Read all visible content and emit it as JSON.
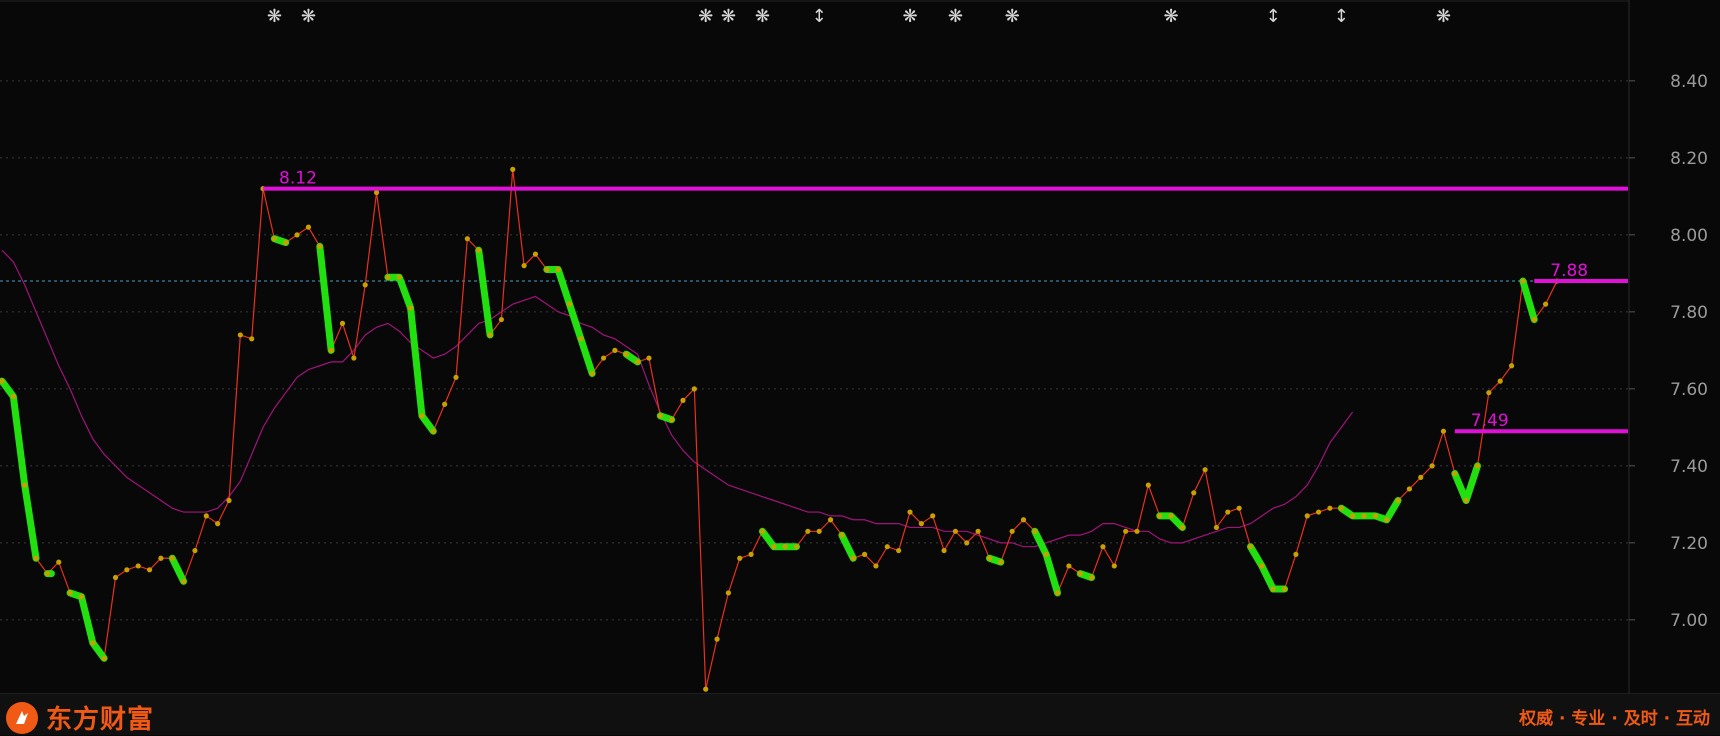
{
  "chart_data": {
    "type": "line",
    "ylim": [
      6.81,
      8.61
    ],
    "y_ticks": [
      "8.40",
      "8.20",
      "8.00",
      "7.80",
      "7.60",
      "7.40",
      "7.20",
      "7.00"
    ],
    "grid": true,
    "series": [
      {
        "role": "price",
        "color": "#e8301c",
        "marker_color": "#c8a000",
        "values": [
          7.62,
          7.58,
          7.35,
          7.16,
          7.12,
          7.15,
          7.07,
          7.06,
          6.94,
          6.9,
          7.11,
          7.13,
          7.14,
          7.13,
          7.16,
          7.16,
          7.1,
          7.18,
          7.27,
          7.25,
          7.31,
          7.74,
          7.73,
          8.12,
          7.99,
          7.98,
          8.0,
          8.02,
          7.97,
          7.7,
          7.77,
          7.68,
          7.87,
          8.11,
          7.89,
          7.89,
          7.81,
          7.53,
          7.49,
          7.56,
          7.63,
          7.99,
          7.96,
          7.74,
          7.78,
          8.17,
          7.92,
          7.95,
          7.91,
          7.91,
          7.82,
          7.73,
          7.64,
          7.68,
          7.7,
          7.69,
          7.67,
          7.68,
          7.53,
          7.52,
          7.57,
          7.6,
          6.82,
          6.95,
          7.07,
          7.16,
          7.17,
          7.23,
          7.19,
          7.19,
          7.19,
          7.23,
          7.23,
          7.26,
          7.22,
          7.16,
          7.17,
          7.14,
          7.19,
          7.18,
          7.28,
          7.25,
          7.27,
          7.18,
          7.23,
          7.2,
          7.23,
          7.16,
          7.15,
          7.23,
          7.26,
          7.23,
          7.17,
          7.07,
          7.14,
          7.12,
          7.11,
          7.19,
          7.14,
          7.23,
          7.23,
          7.35,
          7.27,
          7.27,
          7.24,
          7.33,
          7.39,
          7.24,
          7.28,
          7.29,
          7.19,
          7.14,
          7.08,
          7.08,
          7.17,
          7.27,
          7.28,
          7.29,
          7.29,
          7.27,
          7.27,
          7.27,
          7.26,
          7.31,
          7.34,
          7.37,
          7.4,
          7.49,
          7.38,
          7.31,
          7.4,
          7.59,
          7.62,
          7.66,
          7.88,
          7.78,
          7.82,
          7.88
        ]
      },
      {
        "role": "moving-average",
        "color": "#a0147a",
        "values": [
          7.96,
          7.93,
          7.87,
          7.8,
          7.73,
          7.66,
          7.6,
          7.53,
          7.47,
          7.43,
          7.4,
          7.37,
          7.35,
          7.33,
          7.31,
          7.29,
          7.28,
          7.28,
          7.28,
          7.29,
          7.32,
          7.36,
          7.43,
          7.5,
          7.55,
          7.59,
          7.63,
          7.65,
          7.66,
          7.67,
          7.67,
          7.7,
          7.74,
          7.76,
          7.77,
          7.75,
          7.72,
          7.7,
          7.68,
          7.69,
          7.71,
          7.74,
          7.77,
          7.78,
          7.8,
          7.82,
          7.83,
          7.84,
          7.82,
          7.8,
          7.79,
          7.77,
          7.76,
          7.74,
          7.73,
          7.71,
          7.69,
          7.61,
          7.54,
          7.48,
          7.44,
          7.41,
          7.39,
          7.37,
          7.35,
          7.34,
          7.33,
          7.32,
          7.31,
          7.3,
          7.29,
          7.28,
          7.28,
          7.27,
          7.27,
          7.26,
          7.26,
          7.25,
          7.25,
          7.25,
          7.24,
          7.24,
          7.24,
          7.23,
          7.23,
          7.23,
          7.22,
          7.21,
          7.2,
          7.2,
          7.19,
          7.19,
          7.2,
          7.21,
          7.22,
          7.22,
          7.23,
          7.25,
          7.25,
          7.24,
          7.23,
          7.23,
          7.21,
          7.2,
          7.2,
          7.21,
          7.22,
          7.23,
          7.24,
          7.24,
          7.25,
          7.27,
          7.29,
          7.3,
          7.32,
          7.35,
          7.4,
          7.46,
          7.5,
          7.54
        ],
        "x_start": 0
      }
    ],
    "down_segments": [
      [
        0,
        3
      ],
      [
        4,
        4
      ],
      [
        6,
        9
      ],
      [
        15,
        16
      ],
      [
        24,
        25
      ],
      [
        28,
        29
      ],
      [
        34,
        38
      ],
      [
        42,
        43
      ],
      [
        48,
        52
      ],
      [
        55,
        56
      ],
      [
        58,
        59
      ],
      [
        67,
        70
      ],
      [
        74,
        75
      ],
      [
        87,
        88
      ],
      [
        91,
        93
      ],
      [
        95,
        96
      ],
      [
        102,
        104
      ],
      [
        110,
        113
      ],
      [
        118,
        123
      ],
      [
        128,
        130
      ],
      [
        134,
        135
      ]
    ],
    "levels": [
      {
        "value": 8.12,
        "label": "8.12",
        "color": "#e010d8",
        "from_index": 23
      },
      {
        "value": 7.49,
        "label": "7.49",
        "color": "#e010d8",
        "from_index": 128
      },
      {
        "value": 7.88,
        "label": "7.88",
        "color": "#e010d8",
        "from_index": 135
      }
    ],
    "current_price_line": {
      "value": 7.88,
      "color": "#4aa0c8"
    },
    "top_markers": [
      {
        "index": 24,
        "symbol": "❋"
      },
      {
        "index": 27,
        "symbol": "❋"
      },
      {
        "index": 62,
        "symbol": "❋"
      },
      {
        "index": 64,
        "symbol": "❋"
      },
      {
        "index": 67,
        "symbol": "❋"
      },
      {
        "index": 72,
        "symbol": "↕"
      },
      {
        "index": 80,
        "symbol": "❋"
      },
      {
        "index": 84,
        "symbol": "❋"
      },
      {
        "index": 89,
        "symbol": "❋"
      },
      {
        "index": 103,
        "symbol": "❋"
      },
      {
        "index": 112,
        "symbol": "↕"
      },
      {
        "index": 118,
        "symbol": "↕"
      },
      {
        "index": 127,
        "symbol": "❋"
      }
    ]
  },
  "footer": {
    "brand_name": "东方财富",
    "slogan": "权威 · 专业 · 及时 · 互动"
  },
  "colors": {
    "background": "#080808",
    "accent": "#f05a14",
    "down_highlight": "#22e010",
    "axis_text": "#9a9a9a"
  }
}
